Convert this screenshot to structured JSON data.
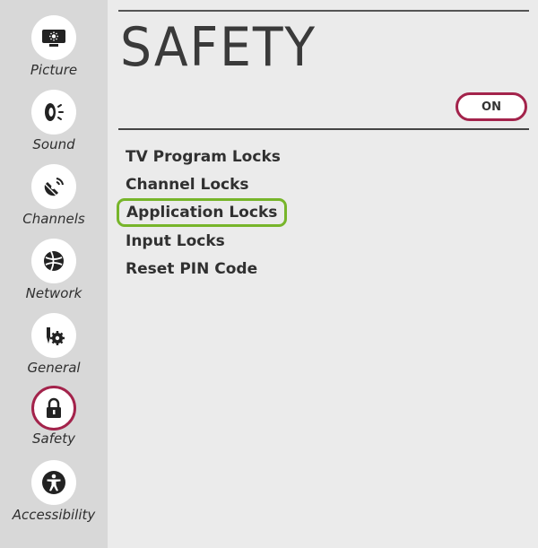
{
  "sidebar": {
    "items": [
      {
        "label": "Picture",
        "icon": "picture-icon",
        "active": false
      },
      {
        "label": "Sound",
        "icon": "sound-icon",
        "active": false
      },
      {
        "label": "Channels",
        "icon": "channels-icon",
        "active": false
      },
      {
        "label": "Network",
        "icon": "network-icon",
        "active": false
      },
      {
        "label": "General",
        "icon": "general-icon",
        "active": false
      },
      {
        "label": "Safety",
        "icon": "lock-icon",
        "active": true
      },
      {
        "label": "Accessibility",
        "icon": "accessibility-icon",
        "active": false
      }
    ]
  },
  "main": {
    "title": "SAFETY",
    "toggle_label": "ON",
    "menu": [
      {
        "label": "TV Program Locks",
        "selected": false
      },
      {
        "label": "Channel Locks",
        "selected": false
      },
      {
        "label": "Application Locks",
        "selected": true
      },
      {
        "label": "Input Locks",
        "selected": false
      },
      {
        "label": "Reset PIN Code",
        "selected": false
      }
    ]
  },
  "colors": {
    "accent": "#a3234b",
    "focus": "#77b52a",
    "sidebar_bg": "#d8d8d8",
    "main_bg": "#ebebeb"
  }
}
